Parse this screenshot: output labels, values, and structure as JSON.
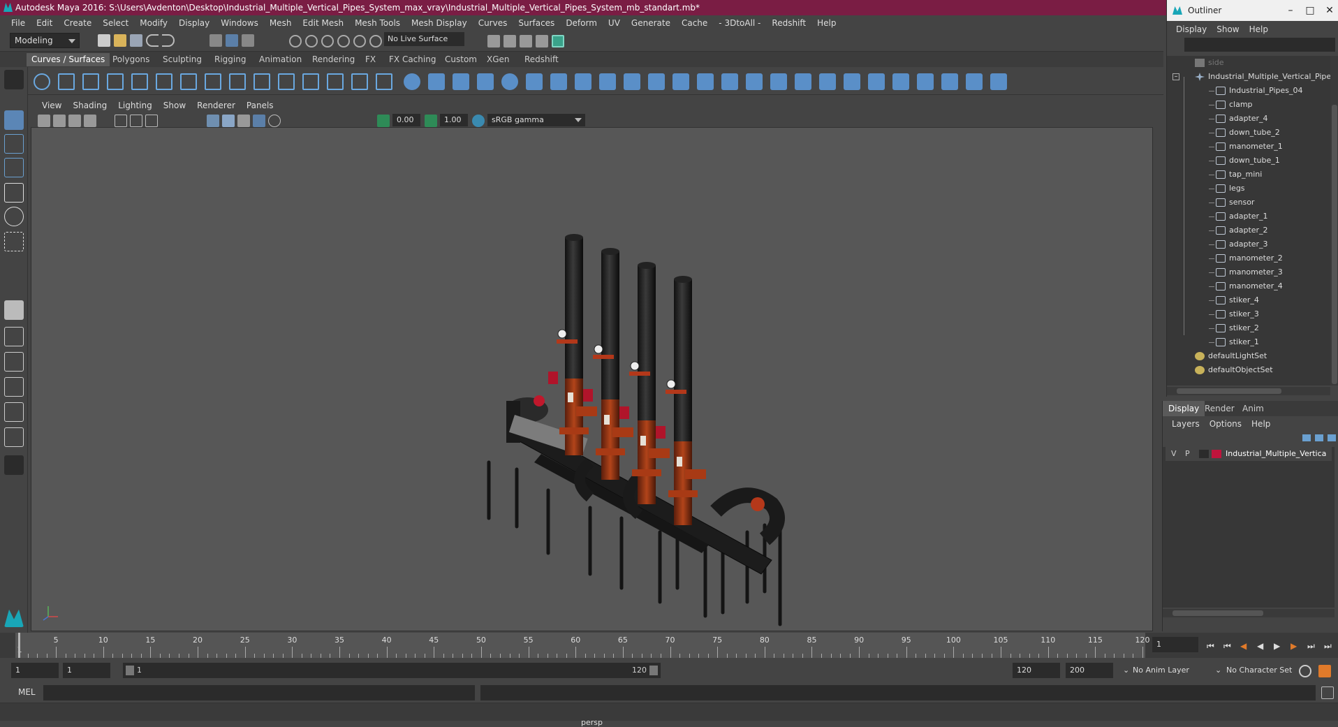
{
  "window": {
    "title": "Autodesk Maya 2016: S:\\Users\\Avdenton\\Desktop\\Industrial_Multiple_Vertical_Pipes_System_max_vray\\Industrial_Multiple_Vertical_Pipes_System_mb_standart.mb*"
  },
  "menubar": [
    "File",
    "Edit",
    "Create",
    "Select",
    "Modify",
    "Display",
    "Windows",
    "Mesh",
    "Edit Mesh",
    "Mesh Tools",
    "Mesh Display",
    "Curves",
    "Surfaces",
    "Deform",
    "UV",
    "Generate",
    "Cache",
    "- 3DtoAll -",
    "Redshift",
    "Help"
  ],
  "statusline": {
    "mode": "Modeling",
    "live_surface": "No Live Surface"
  },
  "shelf_tabs": [
    "Curves / Surfaces",
    "Polygons",
    "Sculpting",
    "Rigging",
    "Animation",
    "Rendering",
    "FX",
    "FX Caching",
    "Custom",
    "XGen",
    "Redshift"
  ],
  "viewport": {
    "menu": [
      "View",
      "Shading",
      "Lighting",
      "Show",
      "Renderer",
      "Panels"
    ],
    "exposure": "0.00",
    "gamma": "1.00",
    "color_space": "sRGB gamma",
    "camera_label": "persp"
  },
  "outliner": {
    "title": "Outliner",
    "menu": [
      "Display",
      "Show",
      "Help"
    ],
    "items": [
      {
        "label": "side",
        "depth": 1,
        "kind": "camera",
        "dim": true
      },
      {
        "label": "Industrial_Multiple_Vertical_Pipes",
        "depth": 1,
        "kind": "group",
        "expanded": true
      },
      {
        "label": "Industrial_Pipes_04",
        "depth": 2,
        "kind": "mesh"
      },
      {
        "label": "clamp",
        "depth": 2,
        "kind": "mesh"
      },
      {
        "label": "adapter_4",
        "depth": 2,
        "kind": "mesh"
      },
      {
        "label": "down_tube_2",
        "depth": 2,
        "kind": "mesh"
      },
      {
        "label": "manometer_1",
        "depth": 2,
        "kind": "mesh"
      },
      {
        "label": "down_tube_1",
        "depth": 2,
        "kind": "mesh"
      },
      {
        "label": "tap_mini",
        "depth": 2,
        "kind": "mesh"
      },
      {
        "label": "legs",
        "depth": 2,
        "kind": "mesh"
      },
      {
        "label": "sensor",
        "depth": 2,
        "kind": "mesh"
      },
      {
        "label": "adapter_1",
        "depth": 2,
        "kind": "mesh"
      },
      {
        "label": "adapter_2",
        "depth": 2,
        "kind": "mesh"
      },
      {
        "label": "adapter_3",
        "depth": 2,
        "kind": "mesh"
      },
      {
        "label": "manometer_2",
        "depth": 2,
        "kind": "mesh"
      },
      {
        "label": "manometer_3",
        "depth": 2,
        "kind": "mesh"
      },
      {
        "label": "manometer_4",
        "depth": 2,
        "kind": "mesh"
      },
      {
        "label": "stiker_4",
        "depth": 2,
        "kind": "mesh"
      },
      {
        "label": "stiker_3",
        "depth": 2,
        "kind": "mesh"
      },
      {
        "label": "stiker_2",
        "depth": 2,
        "kind": "mesh"
      },
      {
        "label": "stiker_1",
        "depth": 2,
        "kind": "mesh"
      },
      {
        "label": "defaultLightSet",
        "depth": 1,
        "kind": "set"
      },
      {
        "label": "defaultObjectSet",
        "depth": 1,
        "kind": "set"
      }
    ]
  },
  "layer_editor": {
    "tabs": [
      "Display",
      "Render",
      "Anim"
    ],
    "menu": [
      "Layers",
      "Options",
      "Help"
    ],
    "layer": {
      "v": "V",
      "p": "P",
      "name": "Industrial_Multiple_Vertica",
      "color": "#c0143c"
    }
  },
  "timeline": {
    "ticks": [
      "5",
      "10",
      "15",
      "20",
      "25",
      "30",
      "35",
      "40",
      "45",
      "50",
      "55",
      "60",
      "65",
      "70",
      "75",
      "80",
      "85",
      "90",
      "95",
      "100",
      "105",
      "110",
      "115",
      "120"
    ],
    "start_tick": "1",
    "current_frame": "1"
  },
  "range": {
    "start": "1",
    "start2": "1",
    "slider_start": "1",
    "slider_end": "120",
    "end": "120",
    "end2": "200",
    "anim_layer": "No Anim Layer",
    "character_set": "No Character Set"
  },
  "cmdline": {
    "label": "MEL"
  }
}
